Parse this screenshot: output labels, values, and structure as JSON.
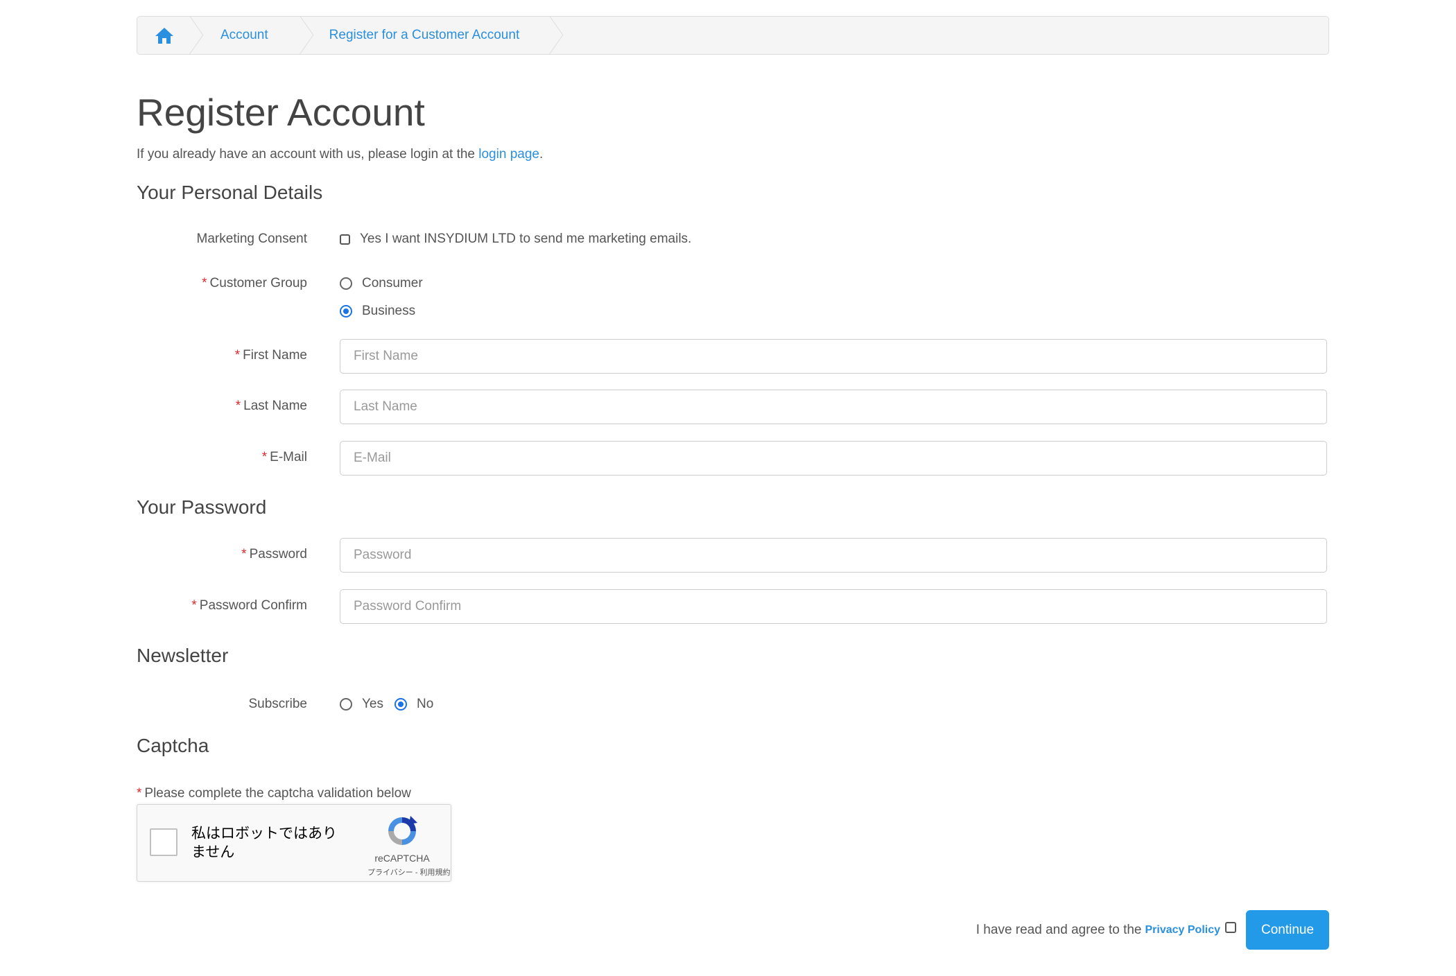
{
  "breadcrumb": {
    "home_icon": "home-icon",
    "items": [
      {
        "label": "Account"
      },
      {
        "label": "Register for a Customer Account"
      }
    ]
  },
  "page": {
    "title": "Register Account",
    "intro_text": "If you already have an account with us, please login at the ",
    "intro_link": "login page",
    "intro_end": "."
  },
  "personal": {
    "heading": "Your Personal Details",
    "marketing_label": "Marketing Consent",
    "marketing_option": "Yes I want INSYDIUM LTD to send me marketing emails.",
    "marketing_checked": false,
    "customer_group_label": "Customer Group",
    "customer_group_options": [
      "Consumer",
      "Business"
    ],
    "customer_group_selected": "Business",
    "first_name_label": "First Name",
    "first_name_placeholder": "First Name",
    "first_name_value": "",
    "last_name_label": "Last Name",
    "last_name_placeholder": "Last Name",
    "last_name_value": "",
    "email_label": "E-Mail",
    "email_placeholder": "E-Mail",
    "email_value": ""
  },
  "password": {
    "heading": "Your Password",
    "password_label": "Password",
    "password_placeholder": "Password",
    "confirm_label": "Password Confirm",
    "confirm_placeholder": "Password Confirm"
  },
  "newsletter": {
    "heading": "Newsletter",
    "subscribe_label": "Subscribe",
    "options": [
      "Yes",
      "No"
    ],
    "selected": "No"
  },
  "captcha": {
    "heading": "Captcha",
    "note": "Please complete the captcha validation below",
    "checkbox_text": "私はロボットではありません",
    "brand": "reCAPTCHA",
    "terms": "プライバシー - 利用規約"
  },
  "footer": {
    "agree_text": "I have read and agree to the",
    "privacy_link": "Privacy Policy",
    "continue_label": "Continue"
  },
  "colors": {
    "link": "#2a8fde",
    "required": "#e0282e",
    "button": "#229ae8"
  }
}
